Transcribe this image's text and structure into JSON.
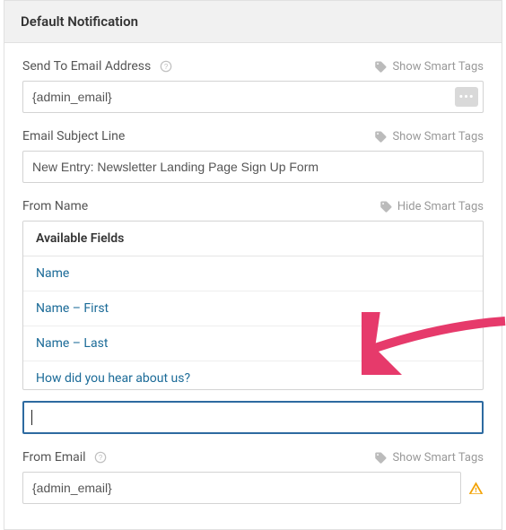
{
  "header": {
    "title": "Default Notification"
  },
  "smart_tags_show": "Show Smart Tags",
  "smart_tags_hide": "Hide Smart Tags",
  "send_to": {
    "label": "Send To Email Address",
    "value": "{admin_email}"
  },
  "subject": {
    "label": "Email Subject Line",
    "value": "New Entry: Newsletter Landing Page Sign Up Form"
  },
  "from_name": {
    "label": "From Name",
    "available_header": "Available Fields",
    "fields": [
      "Name",
      "Name – First",
      "Name – Last",
      "How did you hear about us?"
    ],
    "value": ""
  },
  "from_email": {
    "label": "From Email",
    "value": "{admin_email}"
  }
}
